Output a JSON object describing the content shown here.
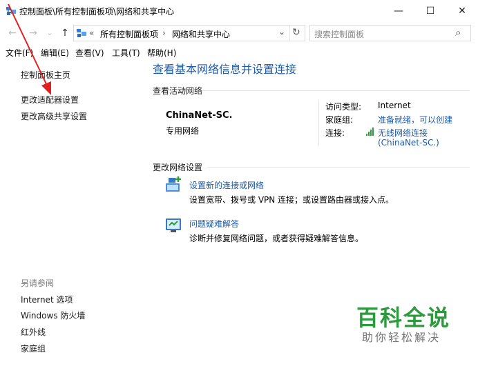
{
  "window": {
    "title": "控制面板\\所有控制面板项\\网络和共享中心",
    "minimize": "—",
    "maximize": "☐",
    "close": "✕"
  },
  "nav": {
    "back": "←",
    "forward": "→",
    "dropdown": "⌄",
    "up": "↑",
    "chevrons": "«",
    "crumb1": "所有控制面板项",
    "sep": "›",
    "crumb2": "网络和共享中心",
    "addr_dropdown": "⌄",
    "refresh": "↻",
    "search_placeholder": "搜索控制面板",
    "search_icon": "⌕"
  },
  "menu": [
    "文件(F)",
    "编辑(E)",
    "查看(V)",
    "工具(T)",
    "帮助(H)"
  ],
  "sidebar": {
    "links": [
      "控制面板主页",
      "更改适配器设置",
      "更改高级共享设置"
    ],
    "see_also_label": "另请参阅",
    "see_also": [
      "Internet 选项",
      "Windows 防火墙",
      "红外线",
      "家庭组"
    ]
  },
  "main": {
    "title": "查看基本网络信息并设置连接",
    "active_heading": "查看活动网络",
    "network_name": "ChinaNet-SC.",
    "network_type": "专用网络",
    "access_type_label": "访问类型:",
    "access_type_value": "Internet",
    "homegroup_label": "家庭组:",
    "homegroup_value": "准备就绪，可以创建",
    "connection_label": "连接:",
    "connection_value_1": "无线网络连接",
    "connection_value_2": "(ChinaNet-SC.)",
    "change_heading": "更改网络设置",
    "tasks": [
      {
        "link": "设置新的连接或网络",
        "desc": "设置宽带、拨号或 VPN 连接；或设置路由器或接入点。"
      },
      {
        "link": "问题疑难解答",
        "desc": "诊断并修复网络问题，或者获得疑难解答信息。"
      }
    ]
  },
  "watermark": {
    "main": "百科全说",
    "sub": "助你轻松解决"
  },
  "colors": {
    "link": "#1e5aa8",
    "watermark": "#2d9a3e",
    "annotation_arrow": "#e02020"
  }
}
